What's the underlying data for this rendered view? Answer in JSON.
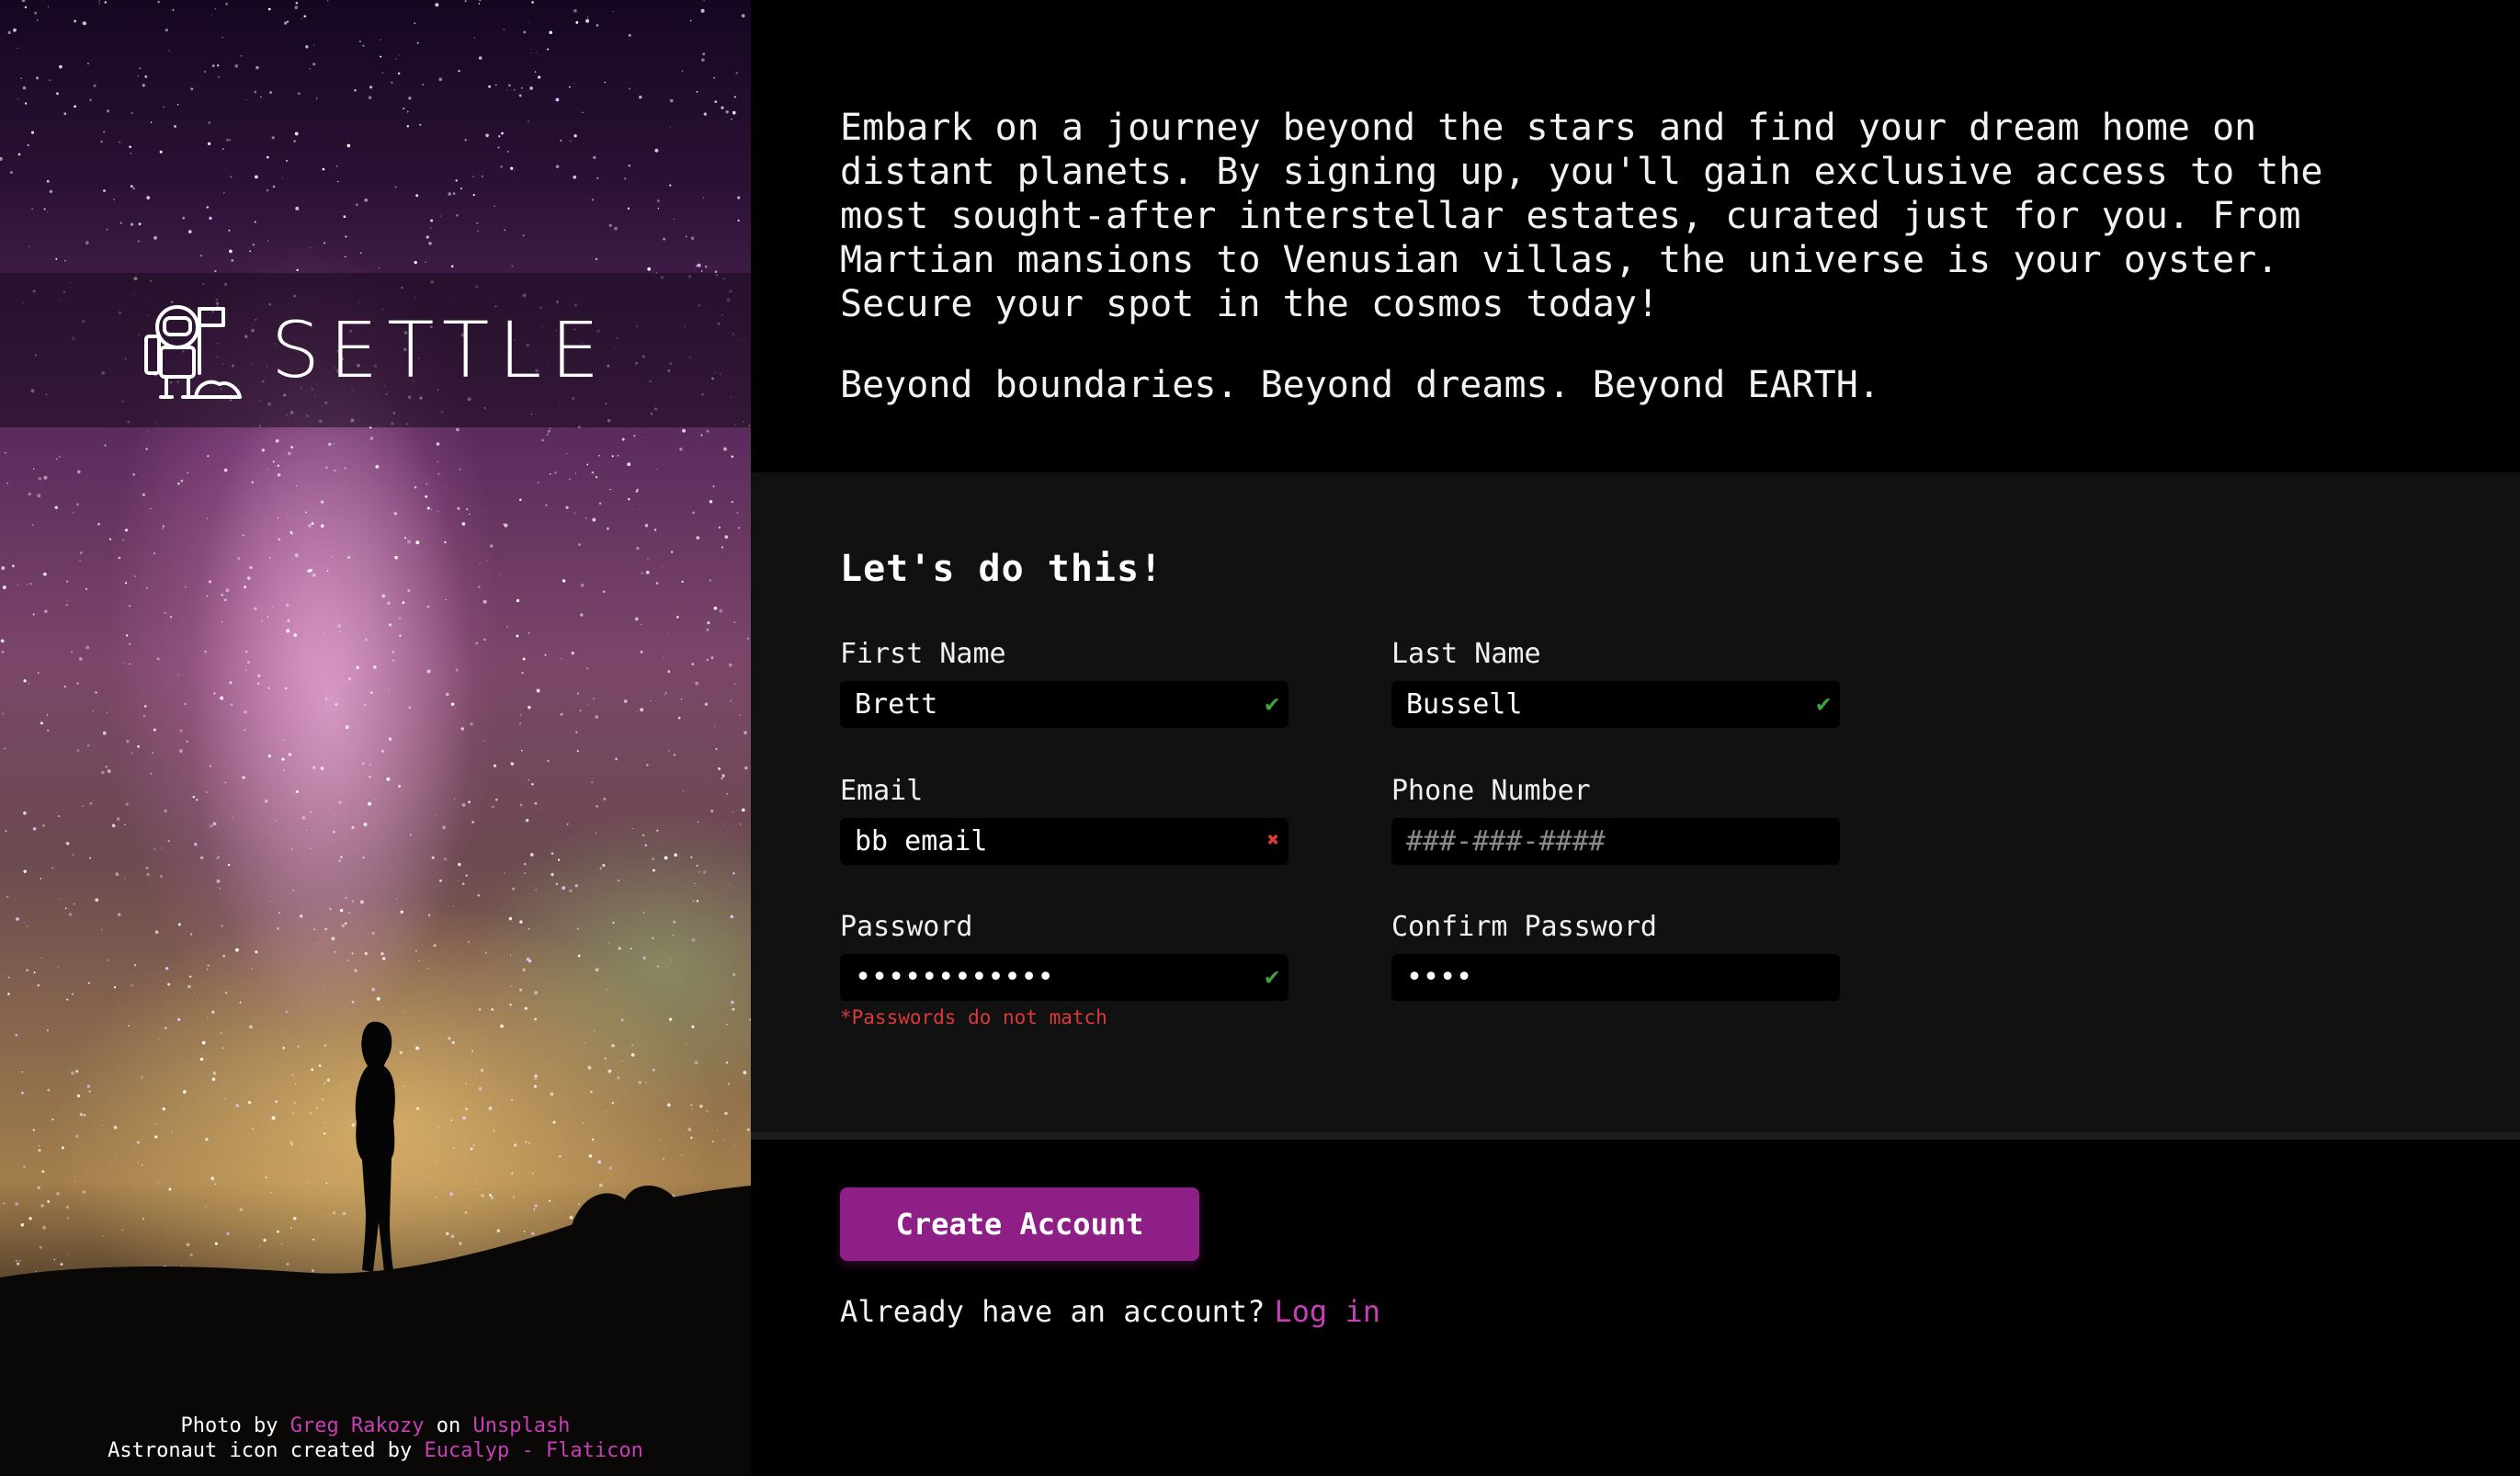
{
  "brand": {
    "name": "SETTLE"
  },
  "credits": {
    "photo_prefix": "Photo by",
    "photo_author": "Greg Rakozy",
    "photo_on": "on",
    "photo_site": "Unsplash",
    "icon_prefix": "Astronaut icon created by",
    "icon_author": "Eucalyp - Flaticon"
  },
  "intro": {
    "paragraph": "Embark on a journey beyond the stars and find your dream home on distant planets. By signing up, you'll gain exclusive access to the most sought-after interstellar estates, curated just for you. From Martian mansions to Venusian villas, the universe is your oyster. Secure your spot in the cosmos today!",
    "tagline": "Beyond boundaries. Beyond dreams. Beyond EARTH."
  },
  "form": {
    "heading": "Let's do this!",
    "first_name": {
      "label": "First Name",
      "value": "Brett",
      "status": "valid"
    },
    "last_name": {
      "label": "Last Name",
      "value": "Bussell",
      "status": "valid"
    },
    "email": {
      "label": "Email",
      "value": "bb email",
      "status": "invalid"
    },
    "phone": {
      "label": "Phone Number",
      "placeholder": "###-###-####",
      "value": ""
    },
    "password": {
      "label": "Password",
      "value": "************",
      "status": "valid",
      "error": "*Passwords do not match"
    },
    "confirm_password": {
      "label": "Confirm Password",
      "value": "****"
    }
  },
  "actions": {
    "create_account": "Create Account",
    "login_prompt": "Already have an account?",
    "login_link": "Log in"
  },
  "icons": {
    "valid": "checkmark-icon",
    "invalid": "cross-icon",
    "brand": "astronaut-icon"
  },
  "colors": {
    "accent": "#8e1f86",
    "link": "#c73fb4",
    "valid": "#3fa33f",
    "error": "#d93a3a",
    "form_bg": "#111111",
    "page_bg": "#000000"
  }
}
